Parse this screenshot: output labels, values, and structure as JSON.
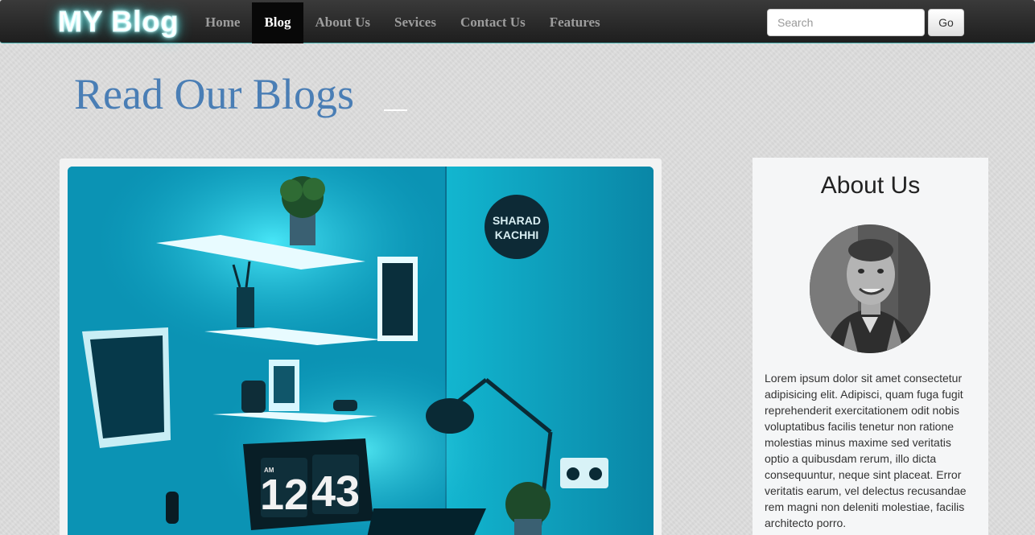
{
  "navbar": {
    "brand": "MY Blog",
    "links": [
      {
        "label": "Home"
      },
      {
        "label": "Blog",
        "active": true
      },
      {
        "label": "About Us"
      },
      {
        "label": "Sevices"
      },
      {
        "label": "Contact Us"
      },
      {
        "label": "Features"
      }
    ],
    "search": {
      "placeholder": "Search",
      "value": ""
    },
    "go_label": "Go"
  },
  "main": {
    "title": "Read Our Blogs"
  },
  "post": {
    "image_icon": "desk-setup-photo",
    "clock_hours": "12",
    "clock_minutes": "43",
    "clock_am": "AM",
    "wall_sign_line1": "SHARAD",
    "wall_sign_line2": "KACHHI"
  },
  "sidebar": {
    "title": "About Us",
    "avatar_icon": "profile-photo",
    "text": "Lorem ipsum dolor sit amet consectetur adipisicing elit. Adipisci, quam fuga fugit reprehenderit exercitationem odit nobis voluptatibus facilis tenetur non ratione molestias minus maxime sed veritatis optio a quibusdam rerum, illo dicta consequuntur, neque sint placeat. Error veritatis earum, vel delectus recusandae rem magni non deleniti molestiae, facilis architecto porro."
  },
  "colors": {
    "navbar_bg": "#222222",
    "active_link_bg": "#080808",
    "title_color": "#4a7eb5",
    "accent_cyan": "#0fa6c4"
  }
}
